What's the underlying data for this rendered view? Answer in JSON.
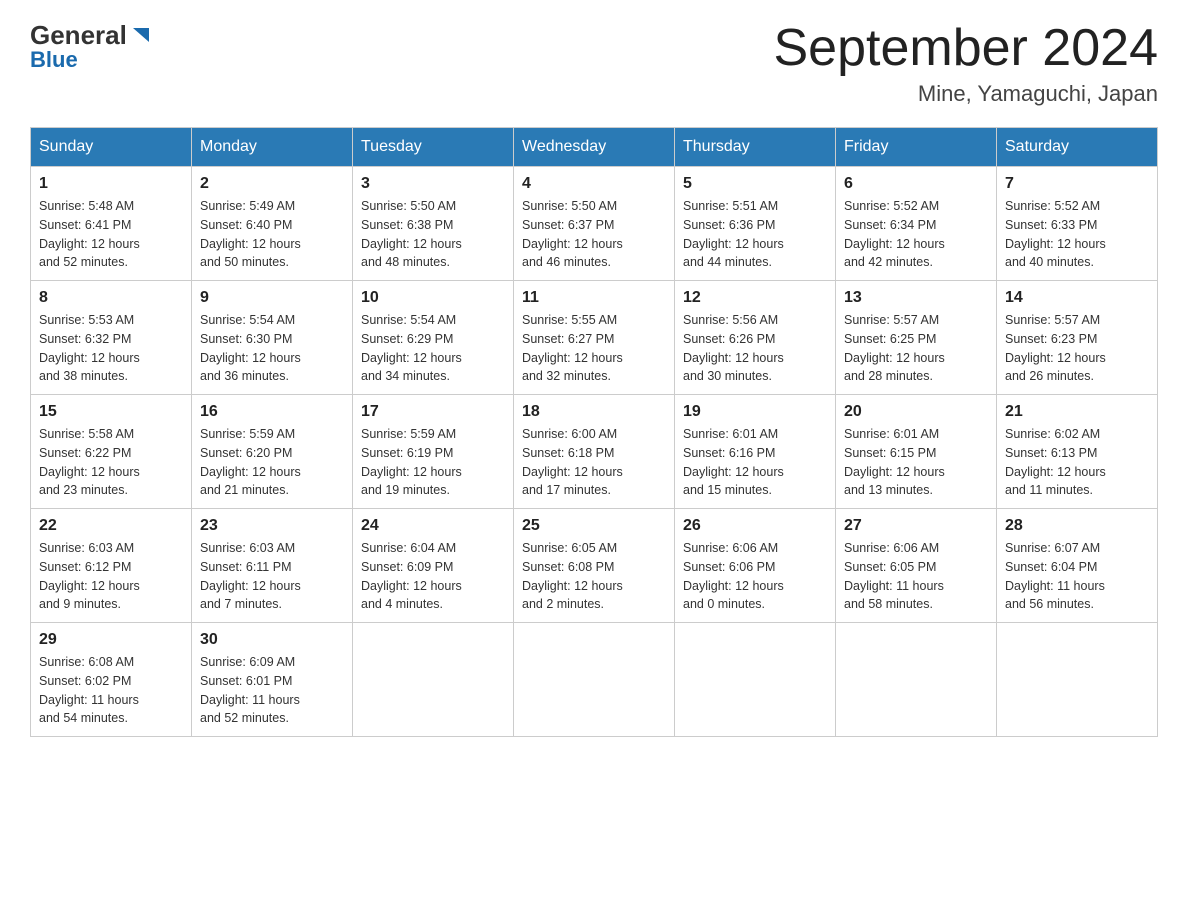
{
  "header": {
    "logo_general": "General",
    "logo_blue": "Blue",
    "month_title": "September 2024",
    "location": "Mine, Yamaguchi, Japan"
  },
  "weekdays": [
    "Sunday",
    "Monday",
    "Tuesday",
    "Wednesday",
    "Thursday",
    "Friday",
    "Saturday"
  ],
  "weeks": [
    [
      {
        "day": "1",
        "sunrise": "5:48 AM",
        "sunset": "6:41 PM",
        "daylight_hours": "12",
        "daylight_minutes": "52"
      },
      {
        "day": "2",
        "sunrise": "5:49 AM",
        "sunset": "6:40 PM",
        "daylight_hours": "12",
        "daylight_minutes": "50"
      },
      {
        "day": "3",
        "sunrise": "5:50 AM",
        "sunset": "6:38 PM",
        "daylight_hours": "12",
        "daylight_minutes": "48"
      },
      {
        "day": "4",
        "sunrise": "5:50 AM",
        "sunset": "6:37 PM",
        "daylight_hours": "12",
        "daylight_minutes": "46"
      },
      {
        "day": "5",
        "sunrise": "5:51 AM",
        "sunset": "6:36 PM",
        "daylight_hours": "12",
        "daylight_minutes": "44"
      },
      {
        "day": "6",
        "sunrise": "5:52 AM",
        "sunset": "6:34 PM",
        "daylight_hours": "12",
        "daylight_minutes": "42"
      },
      {
        "day": "7",
        "sunrise": "5:52 AM",
        "sunset": "6:33 PM",
        "daylight_hours": "12",
        "daylight_minutes": "40"
      }
    ],
    [
      {
        "day": "8",
        "sunrise": "5:53 AM",
        "sunset": "6:32 PM",
        "daylight_hours": "12",
        "daylight_minutes": "38"
      },
      {
        "day": "9",
        "sunrise": "5:54 AM",
        "sunset": "6:30 PM",
        "daylight_hours": "12",
        "daylight_minutes": "36"
      },
      {
        "day": "10",
        "sunrise": "5:54 AM",
        "sunset": "6:29 PM",
        "daylight_hours": "12",
        "daylight_minutes": "34"
      },
      {
        "day": "11",
        "sunrise": "5:55 AM",
        "sunset": "6:27 PM",
        "daylight_hours": "12",
        "daylight_minutes": "32"
      },
      {
        "day": "12",
        "sunrise": "5:56 AM",
        "sunset": "6:26 PM",
        "daylight_hours": "12",
        "daylight_minutes": "30"
      },
      {
        "day": "13",
        "sunrise": "5:57 AM",
        "sunset": "6:25 PM",
        "daylight_hours": "12",
        "daylight_minutes": "28"
      },
      {
        "day": "14",
        "sunrise": "5:57 AM",
        "sunset": "6:23 PM",
        "daylight_hours": "12",
        "daylight_minutes": "26"
      }
    ],
    [
      {
        "day": "15",
        "sunrise": "5:58 AM",
        "sunset": "6:22 PM",
        "daylight_hours": "12",
        "daylight_minutes": "23"
      },
      {
        "day": "16",
        "sunrise": "5:59 AM",
        "sunset": "6:20 PM",
        "daylight_hours": "12",
        "daylight_minutes": "21"
      },
      {
        "day": "17",
        "sunrise": "5:59 AM",
        "sunset": "6:19 PM",
        "daylight_hours": "12",
        "daylight_minutes": "19"
      },
      {
        "day": "18",
        "sunrise": "6:00 AM",
        "sunset": "6:18 PM",
        "daylight_hours": "12",
        "daylight_minutes": "17"
      },
      {
        "day": "19",
        "sunrise": "6:01 AM",
        "sunset": "6:16 PM",
        "daylight_hours": "12",
        "daylight_minutes": "15"
      },
      {
        "day": "20",
        "sunrise": "6:01 AM",
        "sunset": "6:15 PM",
        "daylight_hours": "12",
        "daylight_minutes": "13"
      },
      {
        "day": "21",
        "sunrise": "6:02 AM",
        "sunset": "6:13 PM",
        "daylight_hours": "12",
        "daylight_minutes": "11"
      }
    ],
    [
      {
        "day": "22",
        "sunrise": "6:03 AM",
        "sunset": "6:12 PM",
        "daylight_hours": "12",
        "daylight_minutes": "9"
      },
      {
        "day": "23",
        "sunrise": "6:03 AM",
        "sunset": "6:11 PM",
        "daylight_hours": "12",
        "daylight_minutes": "7"
      },
      {
        "day": "24",
        "sunrise": "6:04 AM",
        "sunset": "6:09 PM",
        "daylight_hours": "12",
        "daylight_minutes": "4"
      },
      {
        "day": "25",
        "sunrise": "6:05 AM",
        "sunset": "6:08 PM",
        "daylight_hours": "12",
        "daylight_minutes": "2"
      },
      {
        "day": "26",
        "sunrise": "6:06 AM",
        "sunset": "6:06 PM",
        "daylight_hours": "12",
        "daylight_minutes": "0"
      },
      {
        "day": "27",
        "sunrise": "6:06 AM",
        "sunset": "6:05 PM",
        "daylight_hours": "11",
        "daylight_minutes": "58"
      },
      {
        "day": "28",
        "sunrise": "6:07 AM",
        "sunset": "6:04 PM",
        "daylight_hours": "11",
        "daylight_minutes": "56"
      }
    ],
    [
      {
        "day": "29",
        "sunrise": "6:08 AM",
        "sunset": "6:02 PM",
        "daylight_hours": "11",
        "daylight_minutes": "54"
      },
      {
        "day": "30",
        "sunrise": "6:09 AM",
        "sunset": "6:01 PM",
        "daylight_hours": "11",
        "daylight_minutes": "52"
      },
      null,
      null,
      null,
      null,
      null
    ]
  ],
  "labels": {
    "sunrise": "Sunrise:",
    "sunset": "Sunset:",
    "daylight": "Daylight:",
    "hours_and": "hours and",
    "minutes": "minutes."
  }
}
